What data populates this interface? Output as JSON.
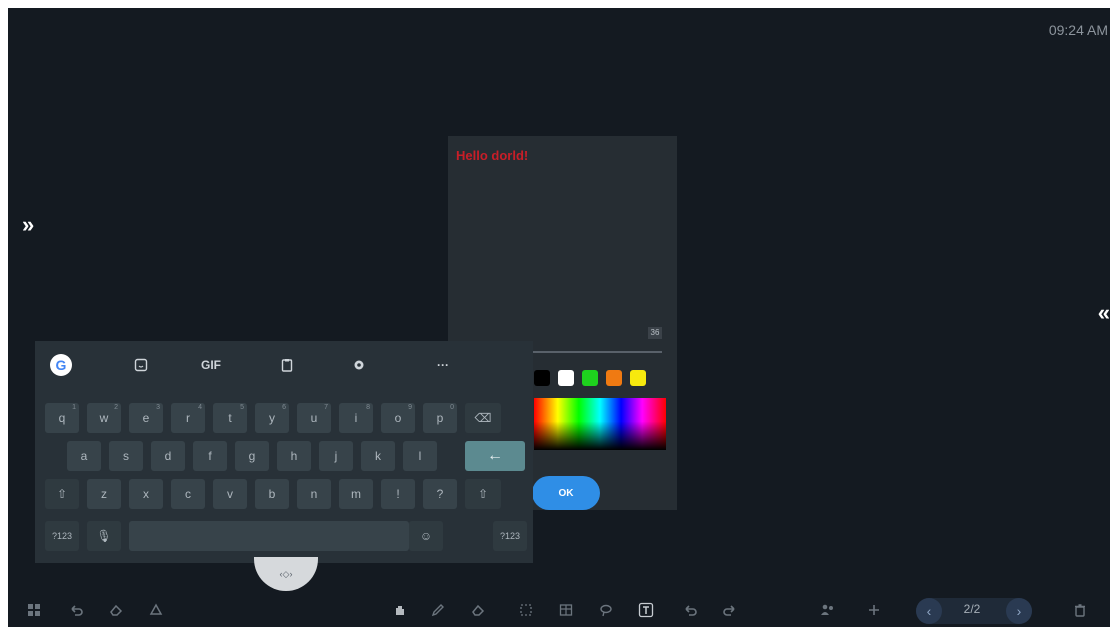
{
  "status": {
    "clock": "09:24 AM"
  },
  "side": {
    "left_expand": "»",
    "right_expand": "«"
  },
  "text_panel": {
    "text": "Hello dorld!",
    "font_size": "36",
    "stroke_fraction": 0.25,
    "swatches": [
      "#7a1d28",
      "#26307a",
      "#5b1f6a",
      "#000000",
      "#ffffff",
      "#1ed11e",
      "#f07a12",
      "#f7e90e"
    ],
    "ok_label": "OK"
  },
  "keyboard": {
    "toolbar": {
      "google": "G",
      "sticker": "sticker-icon",
      "gif": "GIF",
      "clipboard": "clipboard-icon",
      "settings": "gear-icon",
      "more": "···"
    },
    "row1": [
      {
        "k": "q",
        "s": "1"
      },
      {
        "k": "w",
        "s": "2"
      },
      {
        "k": "e",
        "s": "3"
      },
      {
        "k": "r",
        "s": "4"
      },
      {
        "k": "t",
        "s": "5"
      },
      {
        "k": "y",
        "s": "6"
      },
      {
        "k": "u",
        "s": "7"
      },
      {
        "k": "i",
        "s": "8"
      },
      {
        "k": "o",
        "s": "9"
      },
      {
        "k": "p",
        "s": "0"
      }
    ],
    "row2": [
      "a",
      "s",
      "d",
      "f",
      "g",
      "h",
      "j",
      "k",
      "l"
    ],
    "row3": [
      "z",
      "x",
      "c",
      "v",
      "b",
      "n",
      "m",
      "!",
      "?"
    ],
    "num_left": "?123",
    "num_right": "?123",
    "mic": "🎙",
    "emoji": "☺",
    "shift": "⇧",
    "backspace": "⌫",
    "enter": "←"
  },
  "handle": {
    "label": "‹◇›"
  },
  "toolbar": {
    "page_indicator": "2/2",
    "left_tools": [
      "apps-icon",
      "undo-icon",
      "eraser-icon",
      "shapes-icon"
    ],
    "center_tools": [
      "hand-icon",
      "pen-icon",
      "eraser-icon",
      "select-icon",
      "table-icon",
      "lasso-icon",
      "text-icon",
      "undo-icon",
      "redo-icon"
    ],
    "right_tools": [
      "people-icon",
      "add-page-icon",
      "prev-page-icon",
      "next-page-icon",
      "trash-icon"
    ]
  }
}
